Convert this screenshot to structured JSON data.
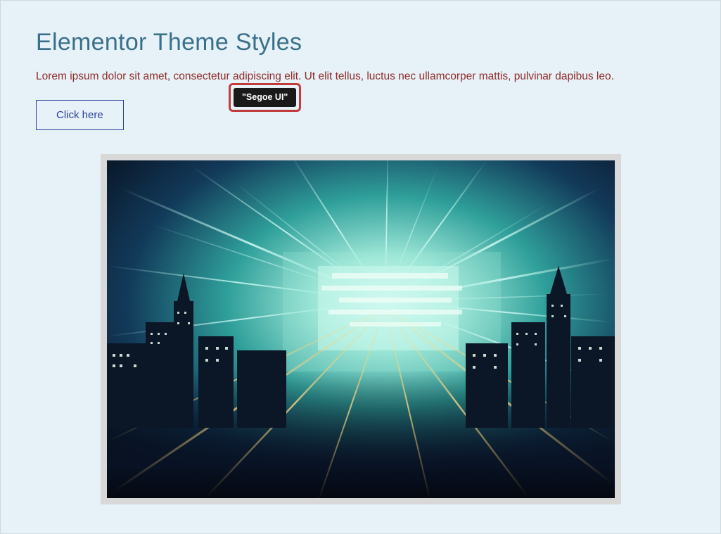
{
  "heading": "Elementor Theme Styles",
  "description": "Lorem ipsum dolor sit amet, consectetur adipiscing elit. Ut elit tellus, luctus nec ullamcorper mattis, pulvinar dapibus leo.",
  "button_label": "Click here",
  "tooltip_text": "\"Segoe UI\""
}
